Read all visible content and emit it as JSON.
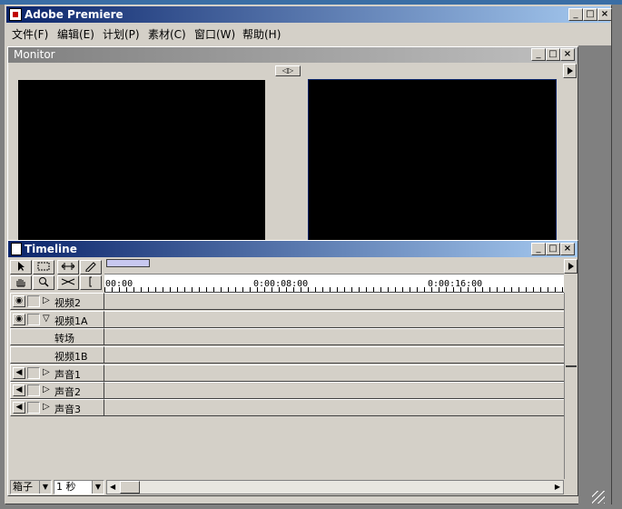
{
  "app": {
    "title": "Adobe Premiere",
    "menu": [
      "文件(F)",
      "编辑(E)",
      "计划(P)",
      "素材(C)",
      "窗口(W)",
      "帮助(H)"
    ]
  },
  "monitor": {
    "title": "Monitor",
    "toggle_label": "◁▷"
  },
  "timeline": {
    "title": "Timeline",
    "ruler_labels": [
      "00:00",
      "0:00:08:00",
      "0:00:16:00"
    ],
    "tracks": [
      {
        "name": "视频2",
        "type": "video",
        "expand": "▷"
      },
      {
        "name": "视频1A",
        "type": "video",
        "expand": "▽"
      },
      {
        "name": "转场",
        "type": "transition",
        "expand": ""
      },
      {
        "name": "视频1B",
        "type": "video",
        "expand": ""
      },
      {
        "name": "声音1",
        "type": "audio",
        "expand": "▷"
      },
      {
        "name": "声音2",
        "type": "audio",
        "expand": "▷"
      },
      {
        "name": "声音3",
        "type": "audio",
        "expand": "▷"
      }
    ],
    "footer": {
      "bin_label": "箱子",
      "zoom_value": "1 秒"
    }
  },
  "icons": {
    "window_controls": [
      "minimize-icon",
      "maximize-icon",
      "close-icon"
    ],
    "video_track": "eye-icon",
    "audio_track": "speaker-icon"
  },
  "colors": {
    "active_title": "#0a246a",
    "inactive_title": "#808080",
    "face": "#d4d0c8",
    "monitor_screen": "#000000"
  }
}
